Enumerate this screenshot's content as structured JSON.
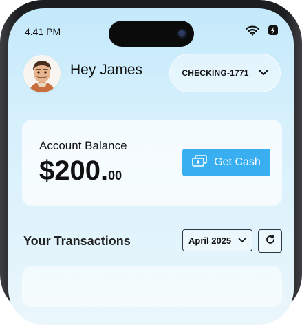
{
  "status_bar": {
    "time": "4.41 PM",
    "icons": [
      "wifi-icon",
      "battery-charging-icon"
    ]
  },
  "header": {
    "greeting": "Hey James",
    "avatar_icon": "avatar-icon",
    "account": {
      "label": "CHECKING-1771",
      "icon": "chevron-down-icon"
    }
  },
  "balance": {
    "title": "Account Balance",
    "amount_main": "$200.",
    "amount_cents": "00",
    "get_cash_label": "Get Cash",
    "get_cash_icon": "cash-icon"
  },
  "transactions": {
    "title": "Your Transactions",
    "month": "April 2025",
    "month_icon": "chevron-down-icon",
    "refresh_icon": "refresh-icon"
  },
  "colors": {
    "accent": "#39aef1",
    "background_top": "#c4e9fb",
    "text": "#111111"
  }
}
